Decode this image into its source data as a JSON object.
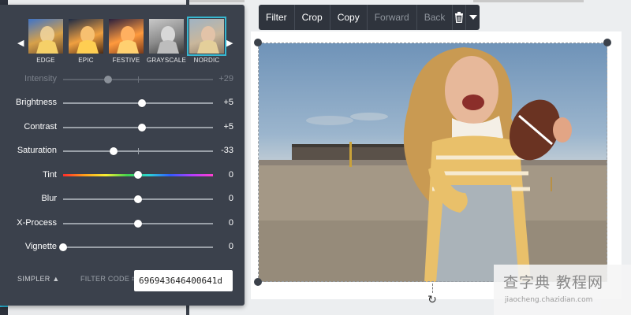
{
  "toolbar": {
    "filter": "Filter",
    "crop": "Crop",
    "copy": "Copy",
    "forward": "Forward",
    "back": "Back",
    "delete_icon": "trash-icon",
    "more_icon": "caret-down-icon"
  },
  "filters": {
    "presets": [
      {
        "label": "EDGE"
      },
      {
        "label": "EPIC"
      },
      {
        "label": "FESTIVE"
      },
      {
        "label": "GRAYSCALE"
      },
      {
        "label": "NORDIC"
      }
    ],
    "selected": "NORDIC",
    "prev_icon": "arrow-left-icon",
    "next_icon": "arrow-right-icon"
  },
  "adjustments": [
    {
      "label": "Intensity",
      "value": "+29",
      "level": 0.3,
      "enabled": false
    },
    {
      "label": "Brightness",
      "value": "+5",
      "level": 0.525
    },
    {
      "label": "Contrast",
      "value": "+5",
      "level": 0.525
    },
    {
      "label": "Saturation",
      "value": "-33",
      "level": 0.335
    },
    {
      "label": "Tint",
      "value": "0",
      "level": 0.5
    },
    {
      "label": "Blur",
      "value": "0",
      "level": 0.5
    },
    {
      "label": "X-Process",
      "value": "0",
      "level": 0.5
    },
    {
      "label": "Vignette",
      "value": "0",
      "level": 0.0
    }
  ],
  "footer": {
    "simpler": "SIMPLER ▲",
    "filter_code_label": "FILTER CODE #",
    "filter_code_value": "696943646400641d"
  },
  "watermark": {
    "main": "查字典 教程网",
    "sub": "jiaocheng.chazidian.com"
  },
  "colors": {
    "panel": "#3b414c",
    "toolbar": "#2f343d",
    "selected_outline": "#37b7d0"
  }
}
